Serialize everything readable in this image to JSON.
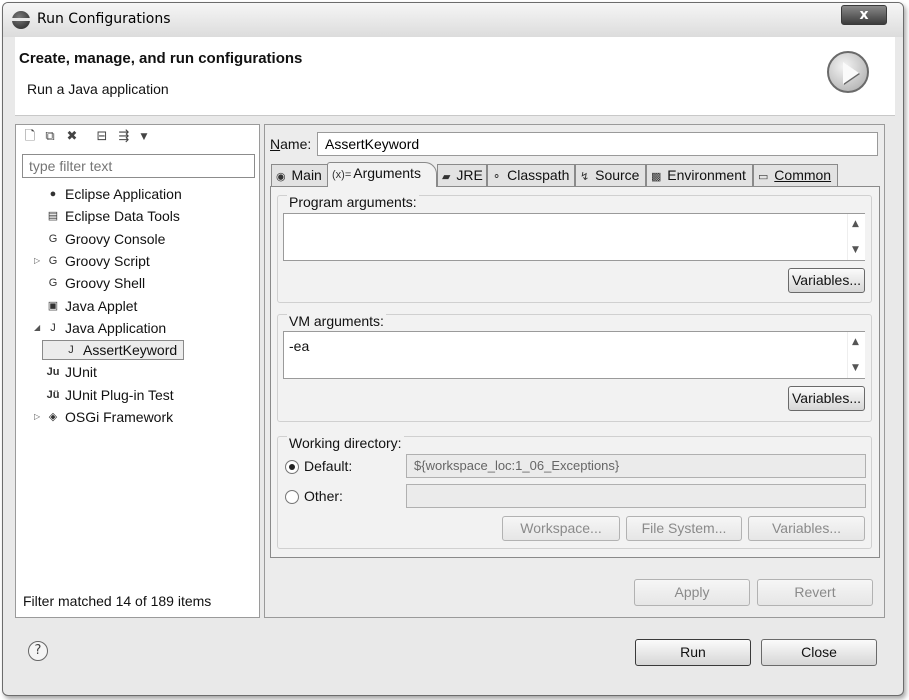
{
  "window": {
    "title": "Run Configurations",
    "close_label": "x"
  },
  "header": {
    "title": "Create, manage, and run configurations",
    "subtitle": "Run a Java application"
  },
  "left": {
    "filter_placeholder": "type filter text",
    "tree": [
      {
        "label": "Eclipse Application",
        "icon": "eclipse-icon",
        "glyph": "●"
      },
      {
        "label": "Eclipse Data Tools",
        "icon": "database-icon",
        "glyph": "▤"
      },
      {
        "label": "Groovy Console",
        "icon": "groovy-icon",
        "glyph": "G"
      },
      {
        "label": "Groovy Script",
        "icon": "groovy-icon",
        "glyph": "G",
        "twisty": "▷"
      },
      {
        "label": "Groovy Shell",
        "icon": "groovy-icon",
        "glyph": "G"
      },
      {
        "label": "Java Applet",
        "icon": "applet-icon",
        "glyph": "▣"
      },
      {
        "label": "Java Application",
        "icon": "java-app-icon",
        "glyph": "J",
        "twisty": "◢"
      },
      {
        "label": "AssertKeyword",
        "icon": "java-app-icon",
        "glyph": "J"
      },
      {
        "label": "JUnit",
        "icon": "junit-icon",
        "glyph": "Ju"
      },
      {
        "label": "JUnit Plug-in Test",
        "icon": "junit-plugin-icon",
        "glyph": "Jü"
      },
      {
        "label": "OSGi Framework",
        "icon": "osgi-icon",
        "glyph": "◈",
        "twisty": "▷"
      }
    ],
    "status": "Filter matched 14 of 189 items"
  },
  "right": {
    "name_label_prefix": "N",
    "name_label_rest": "ame:",
    "name_value": "AssertKeyword",
    "tabs": [
      {
        "label": "Main",
        "glyph": "◉"
      },
      {
        "label": "Arguments",
        "glyph": "(x)="
      },
      {
        "label": "JRE",
        "glyph": "▰"
      },
      {
        "label": "Classpath",
        "glyph": "⚬"
      },
      {
        "label": "Source",
        "glyph": "↯"
      },
      {
        "label": "Environment",
        "glyph": "▩"
      },
      {
        "label": "Common",
        "glyph": "▭"
      }
    ],
    "program_args": {
      "label": "Program arguments:",
      "value": "",
      "variables": "Variables..."
    },
    "vm_args": {
      "label": "VM arguments:",
      "value": "-ea",
      "variables": "Variables..."
    },
    "working_dir": {
      "label": "Working directory:",
      "default_label": "Default:",
      "default_value": "${workspace_loc:1_06_Exceptions}",
      "other_label": "Other:",
      "other_value": "",
      "workspace_btn": "Workspace...",
      "filesystem_btn": "File System...",
      "variables_btn": "Variables..."
    },
    "apply": "Apply",
    "revert": "Revert"
  },
  "footer": {
    "help": "?",
    "run": "Run",
    "close": "Close"
  }
}
